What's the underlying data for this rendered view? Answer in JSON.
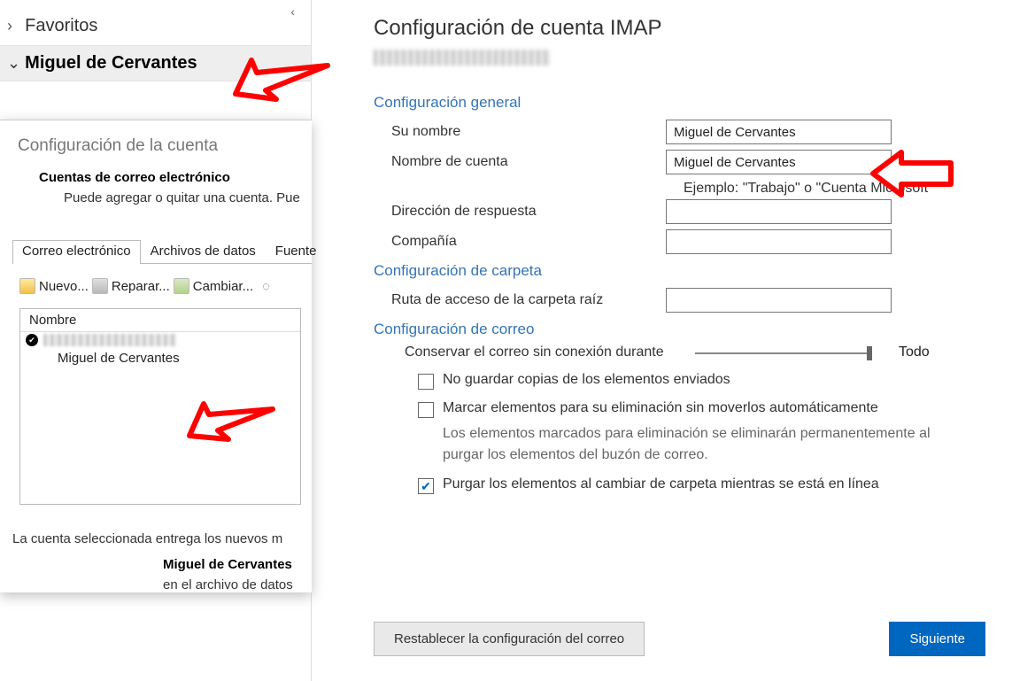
{
  "nav": {
    "favorites_label": "Favoritos"
  },
  "account_header": {
    "name": "Miguel de Cervantes"
  },
  "dialog": {
    "title": "Configuración de la cuenta",
    "section_title": "Cuentas de correo electrónico",
    "section_hint": "Puede agregar o quitar una cuenta. Pue",
    "tabs": {
      "email": "Correo electrónico",
      "data": "Archivos de datos",
      "feeds": "Fuente"
    },
    "toolbar": {
      "new": "Nuevo...",
      "repair": "Reparar...",
      "change": "Cambiar..."
    },
    "col_name": "Nombre",
    "row2": "Miguel de Cervantes",
    "note1": "La cuenta seleccionada entrega los nuevos m",
    "note2": "Miguel de Cervantes",
    "note3": "en el archivo de datos "
  },
  "imap": {
    "title": "Configuración de cuenta IMAP",
    "general": {
      "header": "Configuración general",
      "your_name_label": "Su nombre",
      "your_name_value": "Miguel de Cervantes",
      "account_name_label": "Nombre de cuenta",
      "account_name_value": "Miguel de Cervantes",
      "example": "Ejemplo: \"Trabajo\" o \"Cuenta Microsoft\"",
      "reply_label": "Dirección de respuesta",
      "reply_value": "",
      "company_label": "Compañía",
      "company_value": ""
    },
    "folder": {
      "header": "Configuración de carpeta",
      "root_label": "Ruta de acceso de la carpeta raíz",
      "root_value": ""
    },
    "mail": {
      "header": "Configuración de correo",
      "offline_label": "Conservar el correo sin conexión durante",
      "slider_end": "Todo",
      "chk1_label": "No guardar copias de los elementos enviados",
      "chk1_checked": false,
      "chk2_label": "Marcar elementos para su eliminación sin moverlos automáticamente",
      "chk2_checked": false,
      "chk2_hint": "Los elementos marcados para eliminación se eliminarán permanentemente al purgar los elementos del buzón de correo.",
      "chk3_label": "Purgar los elementos al cambiar de carpeta mientras se está en línea",
      "chk3_checked": true
    },
    "buttons": {
      "reset": "Restablecer la configuración del correo",
      "next": "Siguiente"
    }
  }
}
